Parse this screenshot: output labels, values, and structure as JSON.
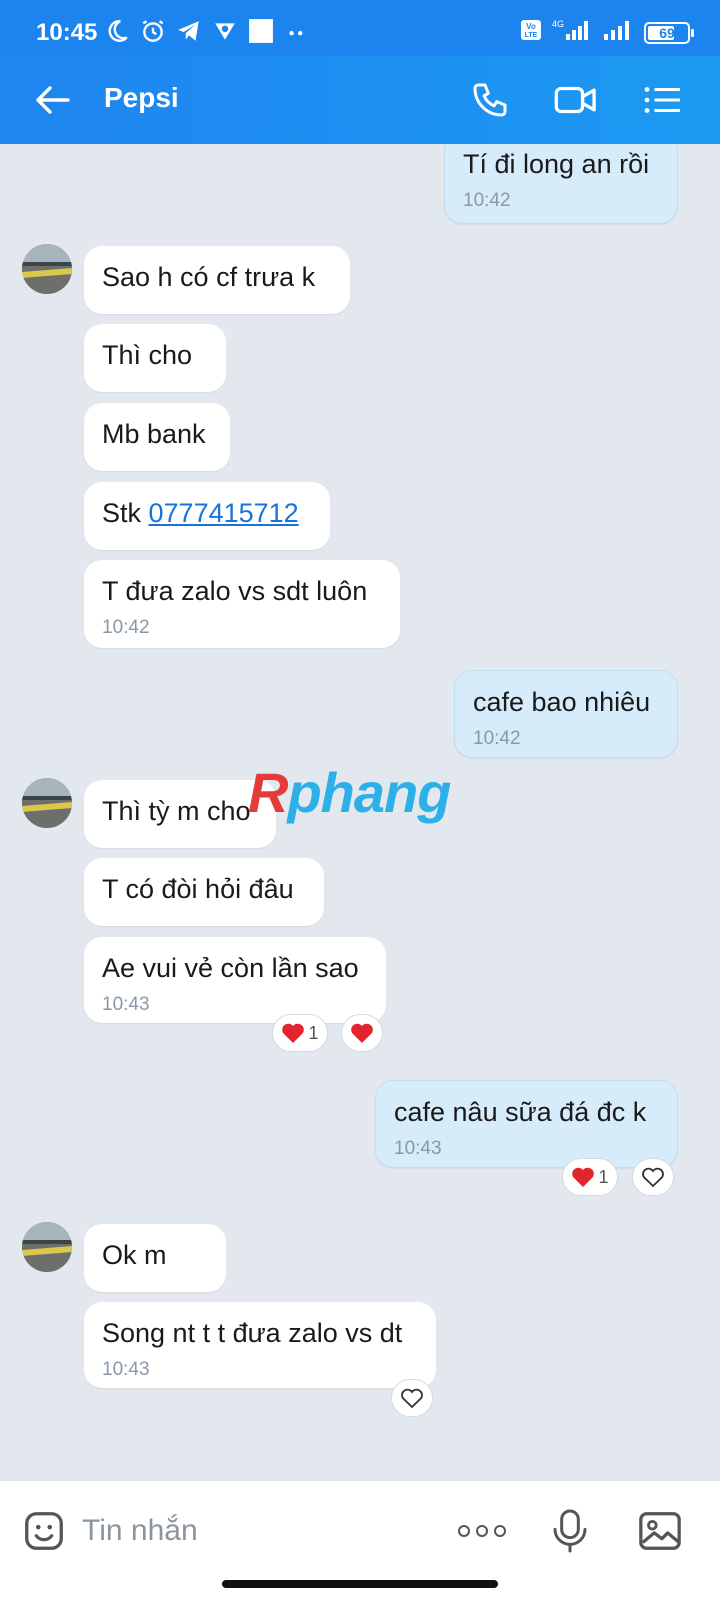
{
  "status_bar": {
    "time": "10:45",
    "battery": "69",
    "battery_level": 0.69,
    "network": "4G",
    "volte": "Vo LTE",
    "left_icons": [
      "moon-icon",
      "alarm-icon",
      "telegram-icon",
      "vpn-icon",
      "square-icon",
      "more-dots-icon"
    ]
  },
  "header": {
    "contact_name": "Pepsi",
    "icons": [
      "back-arrow-icon",
      "phone-icon",
      "video-call-icon",
      "menu-list-icon"
    ]
  },
  "messages": {
    "m1": {
      "text": "Tí đi long an rồi",
      "time": "10:42",
      "direction": "out"
    },
    "m2": {
      "text": "Sao h có cf trưa k",
      "direction": "in"
    },
    "m3": {
      "text": "Thì cho",
      "direction": "in"
    },
    "m4": {
      "text": "Mb bank",
      "direction": "in"
    },
    "m5": {
      "text_prefix": "Stk ",
      "link": "0777415712",
      "direction": "in"
    },
    "m6": {
      "text": "T đưa zalo vs sdt luôn",
      "time": "10:42",
      "direction": "in"
    },
    "m7": {
      "text": "cafe bao nhiêu",
      "time": "10:42",
      "direction": "out"
    },
    "m8": {
      "text": "Thì tỳ m cho",
      "direction": "in"
    },
    "m9": {
      "text": "T có đòi hỏi đâu",
      "direction": "in"
    },
    "m10": {
      "text": "Ae vui vẻ còn lần sao",
      "time": "10:43",
      "direction": "in",
      "reaction_count": "1"
    },
    "m11": {
      "text": "cafe nâu sữa đá đc k",
      "time": "10:43",
      "direction": "out",
      "reaction_count": "1"
    },
    "m12": {
      "text": "Ok m",
      "direction": "in"
    },
    "m13": {
      "text": "Song nt t t đưa zalo vs dt",
      "time": "10:43",
      "direction": "in"
    }
  },
  "watermark": {
    "part1": "R",
    "part2": "phang"
  },
  "input_bar": {
    "placeholder": "Tin nhắn",
    "icons": [
      "sticker-icon",
      "more-options-icon",
      "microphone-icon",
      "image-icon"
    ]
  },
  "colors": {
    "header": "#1c84ee",
    "chat_background": "#e2e8ee",
    "outgoing_bubble": "#d6ecfb",
    "incoming_bubble": "#ffffff",
    "link": "#1a73d6",
    "heart": "#e2242e"
  }
}
